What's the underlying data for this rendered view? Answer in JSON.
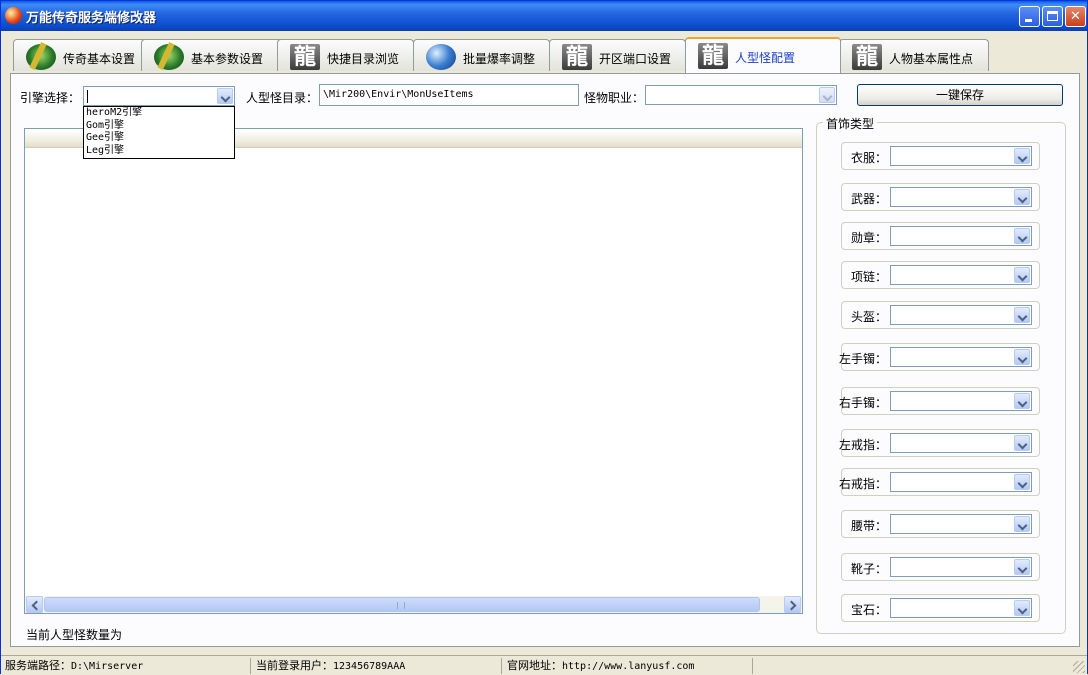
{
  "window": {
    "title": "万能传奇服务端修改器",
    "controls": {
      "minimize": "minimize",
      "maximize": "maximize",
      "close": "✕"
    }
  },
  "tabs": [
    {
      "label": "传奇基本设置",
      "icon": "green-warrior-icon"
    },
    {
      "label": "基本参数设置",
      "icon": "green-warrior-icon"
    },
    {
      "label": "快捷目录浏览",
      "icon": "dragon-char-icon"
    },
    {
      "label": "批量爆率调整",
      "icon": "globe-icon"
    },
    {
      "label": "开区端口设置",
      "icon": "dragon-char-icon"
    },
    {
      "label": "人型怪配置",
      "icon": "dragon-char-icon",
      "active": true
    },
    {
      "label": "人物基本属性点",
      "icon": "dragon-char-icon"
    }
  ],
  "dragon_glyph": "龍",
  "toolbar": {
    "engine_label": "引擎选择：",
    "engine_value": "",
    "engine_options": [
      "heroM2引擎",
      "Gom引擎",
      "Gee引擎",
      "Leg引擎"
    ],
    "dir_label": "人型怪目录：",
    "dir_value": "\\Mir200\\Envir\\MonUseItems",
    "job_label": "怪物职业：",
    "job_value": "",
    "save_label": "一键保存"
  },
  "list": {
    "count_label": "当前人型怪数量为"
  },
  "equipment": {
    "title": "首饰类型",
    "slots": [
      "衣服：",
      "武器：",
      "勋章：",
      "项链：",
      "头盔：",
      "左手镯：",
      "右手镯：",
      "左戒指：",
      "右戒指：",
      "腰带：",
      "靴子：",
      "宝石："
    ]
  },
  "status": {
    "path_label": "服务端路径：",
    "path_value": "D:\\Mirserver",
    "user_label": "当前登录用户：",
    "user_value": "123456789AAA",
    "site_label": "官网地址：",
    "site_value": "http://www.lanyusf.com"
  },
  "colors": {
    "titlebar": "#0a5ae8",
    "active_tab_text": "#1a3ec8",
    "tab_highlight": "#e6a735"
  }
}
